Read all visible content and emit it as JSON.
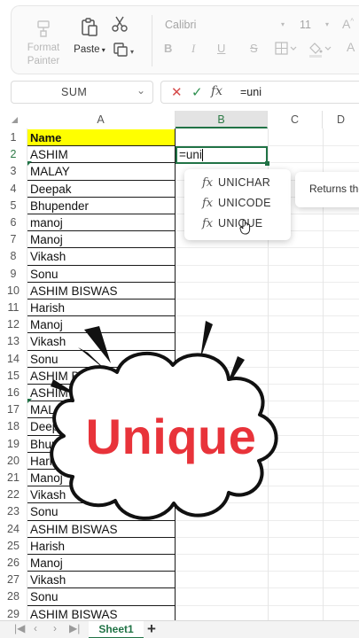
{
  "ribbon": {
    "format_painter_label": "Format\nPainter",
    "paste_label": "Paste",
    "font_name": "Calibri",
    "font_size": "11",
    "bold": "B",
    "italic": "I",
    "underline": "U",
    "strike": "S",
    "font_color_letter": "A"
  },
  "formula_bar": {
    "name_box": "SUM",
    "cancel_symbol": "✕",
    "enter_symbol": "✓",
    "fx_label": "fx",
    "formula": "=uni"
  },
  "grid": {
    "columns": [
      "A",
      "B",
      "C",
      "D"
    ],
    "selected_column": "B",
    "active_cell": "B2",
    "active_cell_value": "=uni",
    "rows": [
      {
        "n": "1",
        "a": "Name"
      },
      {
        "n": "2",
        "a": "ASHIM"
      },
      {
        "n": "3",
        "a": "MALAY"
      },
      {
        "n": "4",
        "a": "Deepak"
      },
      {
        "n": "5",
        "a": "Bhupender"
      },
      {
        "n": "6",
        "a": "manoj"
      },
      {
        "n": "7",
        "a": "Manoj"
      },
      {
        "n": "8",
        "a": "Vikash"
      },
      {
        "n": "9",
        "a": "Sonu"
      },
      {
        "n": "10",
        "a": "ASHIM BISWAS"
      },
      {
        "n": "11",
        "a": "Harish"
      },
      {
        "n": "12",
        "a": "Manoj"
      },
      {
        "n": "13",
        "a": "Vikash"
      },
      {
        "n": "14",
        "a": "Sonu"
      },
      {
        "n": "15",
        "a": "ASHIM BISWAS"
      },
      {
        "n": "16",
        "a": "ASHIM BISWAS"
      },
      {
        "n": "17",
        "a": "MALAY"
      },
      {
        "n": "18",
        "a": "Deepak"
      },
      {
        "n": "19",
        "a": "Bhupender"
      },
      {
        "n": "20",
        "a": "Harish"
      },
      {
        "n": "21",
        "a": "Manoj"
      },
      {
        "n": "22",
        "a": "Vikash"
      },
      {
        "n": "23",
        "a": "Sonu"
      },
      {
        "n": "24",
        "a": "ASHIM BISWAS"
      },
      {
        "n": "25",
        "a": "Harish"
      },
      {
        "n": "26",
        "a": "Manoj"
      },
      {
        "n": "27",
        "a": "Vikash"
      },
      {
        "n": "28",
        "a": "Sonu"
      },
      {
        "n": "29",
        "a": "ASHIM BISWAS"
      }
    ]
  },
  "autocomplete": {
    "options": [
      "UNICHAR",
      "UNICODE",
      "UNIQUE"
    ],
    "icon": "fx",
    "tooltip": "Returns the"
  },
  "sheets": {
    "active": "Sheet1",
    "add_symbol": "+"
  },
  "overlay": {
    "text": "Unique",
    "color": "#e8333a"
  },
  "colors": {
    "accent": "#217346",
    "header_fill": "#ffff00"
  }
}
